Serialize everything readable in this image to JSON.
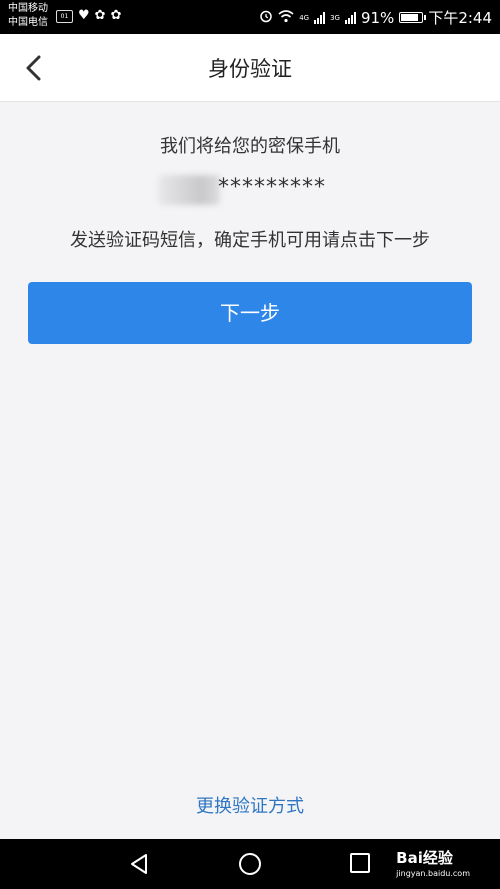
{
  "status_bar": {
    "carrier_1": "中国移动",
    "carrier_2": "中国电信",
    "sim_badge": "01",
    "network_label": "4G",
    "network_label_2": "3G",
    "network_speed": "1",
    "battery_text": "91%",
    "battery_level": 0.91,
    "time": "下午2:44"
  },
  "header": {
    "back_icon": "chevron-left-icon",
    "title": "身份验证"
  },
  "content": {
    "line1": "我们将给您的密保手机",
    "phone_masked": "*********",
    "line2": "发送验证码短信，确定手机可用请点击下一步",
    "next_button": "下一步",
    "switch_method_link": "更换验证方式"
  },
  "system_nav": {
    "back": "triangle-back-icon",
    "home": "circle-home-icon",
    "recents": "square-recents-icon"
  },
  "watermark": {
    "text": "Bai经验",
    "url": "jingyan.baidu.com"
  },
  "colors": {
    "accent": "#2d86e8",
    "link": "#2f76c3",
    "background": "#f4f4f6"
  }
}
